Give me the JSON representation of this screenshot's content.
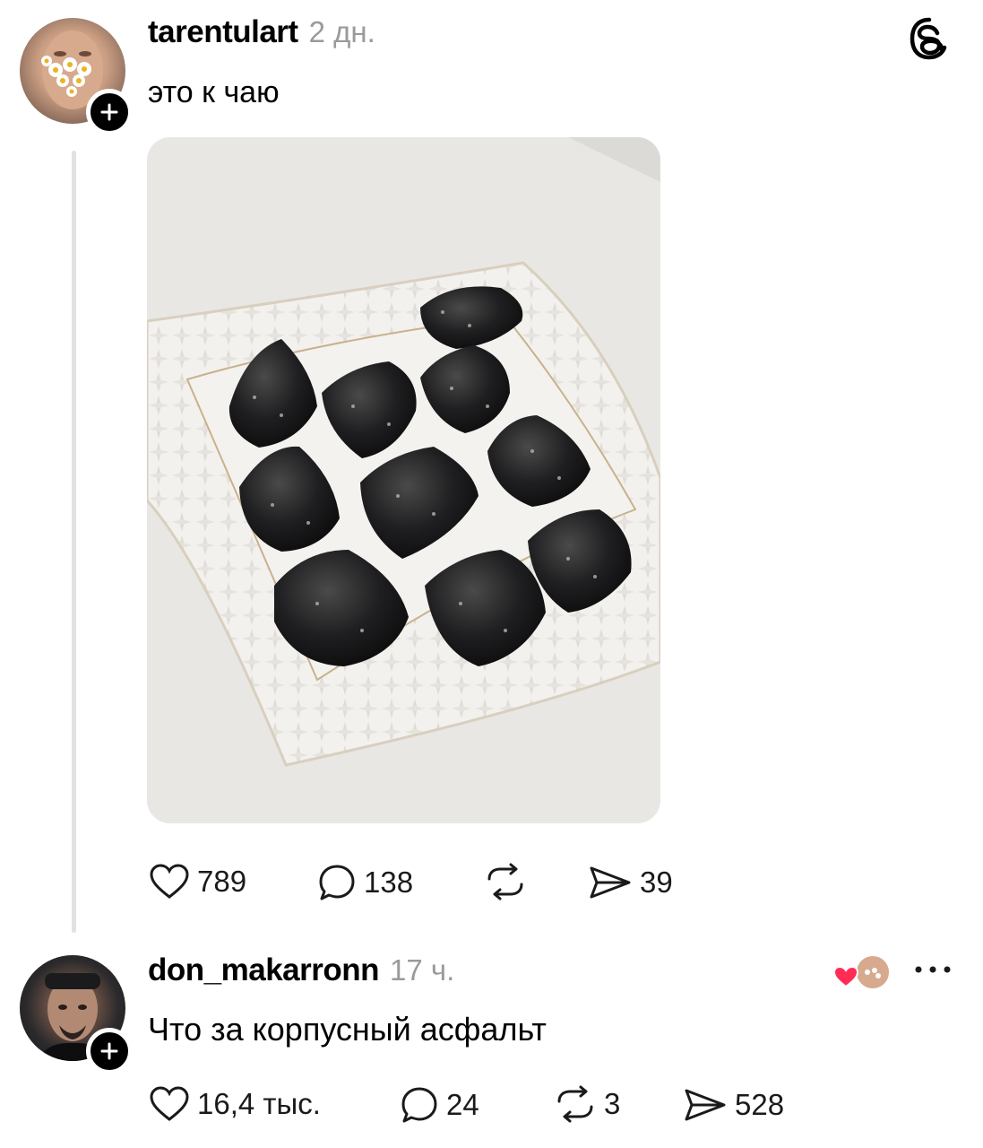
{
  "post": {
    "username": "tarentulart",
    "time": "2 дн.",
    "text": "это к чаю",
    "stats": {
      "likes": "789",
      "replies": "138",
      "shares": "39"
    }
  },
  "reply": {
    "username": "don_makarronn",
    "time": "17 ч.",
    "text": "Что за корпусный асфальт",
    "stats": {
      "likes": "16,4 тыс.",
      "replies": "24",
      "reposts": "3",
      "shares": "528"
    }
  },
  "icons": {
    "logo": "threads-logo-icon",
    "like": "heart-icon",
    "reply": "comment-bubble-icon",
    "repost": "repost-arrows-icon",
    "share": "send-arrow-icon",
    "more": "more-dots-icon",
    "follow": "plus-icon"
  },
  "colors": {
    "heart_liked": "#ff2d55",
    "muted_text": "#9a9a9a",
    "thread_line": "#e1e1e1"
  }
}
